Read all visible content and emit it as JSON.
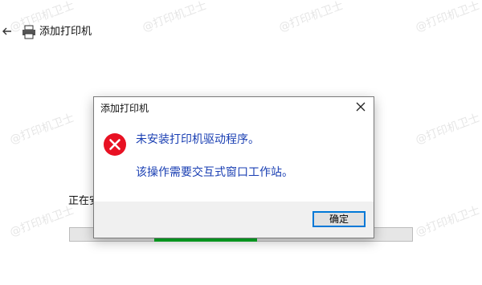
{
  "window": {
    "title": "添加打印机",
    "status_text": "正在安"
  },
  "progress": {
    "fill_fraction_approx": 0.3
  },
  "watermark": {
    "text": "@打印机卫士"
  },
  "dialog": {
    "title": "添加打印机",
    "message_line1": "未安装打印机驱动程序。",
    "message_line2": "该操作需要交互式窗口工作站。",
    "ok_label": "确定"
  },
  "colors": {
    "error_red": "#e81123",
    "message_blue": "#1a3fb3",
    "focus_blue": "#0078d7",
    "progress_green": "#06b025"
  }
}
